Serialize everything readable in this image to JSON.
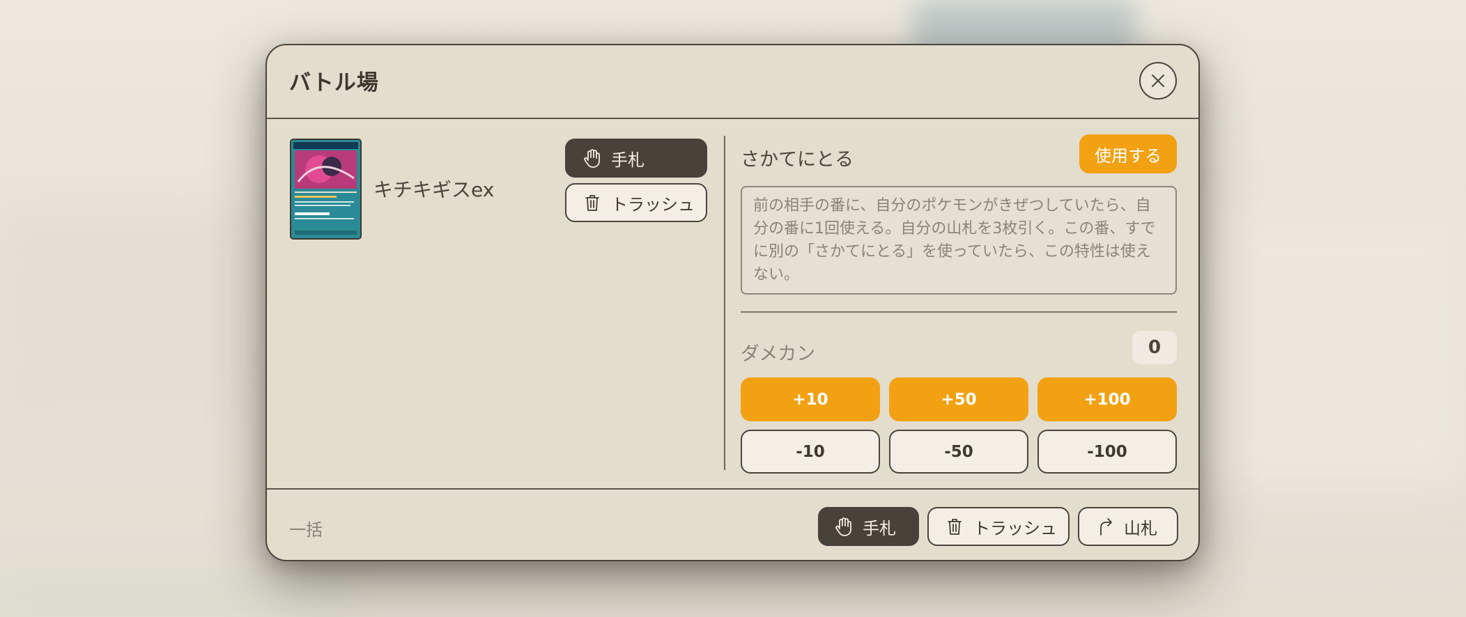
{
  "dialog": {
    "title": "バトル場"
  },
  "card": {
    "name": "キチキギスex",
    "actions": {
      "hand_label": "手札",
      "trash_label": "トラッシュ"
    }
  },
  "ability": {
    "name": "さかてにとる",
    "use_label": "使用する",
    "description": "前の相手の番に、自分のポケモンがきぜつしていたら、自分の番に1回使える。自分の山札を3枚引く。この番、すでに別の「さかてにとる」を使っていたら、この特性は使えない。"
  },
  "damage": {
    "label": "ダメカン",
    "count": "0",
    "plus_buttons": [
      "+10",
      "+50",
      "+100"
    ],
    "minus_buttons": [
      "-10",
      "-50",
      "-100"
    ]
  },
  "footer": {
    "bulk_label": "一括",
    "hand_label": "手札",
    "trash_label": "トラッシュ",
    "deck_label": "山札"
  },
  "colors": {
    "accent": "#f2a113",
    "dark_button": "#47423a",
    "dialog_bg": "#e3ddcd"
  },
  "icons": {
    "close": "close-icon",
    "hand": "hand-icon",
    "trash": "trash-icon",
    "deck": "return-arrow-icon"
  }
}
